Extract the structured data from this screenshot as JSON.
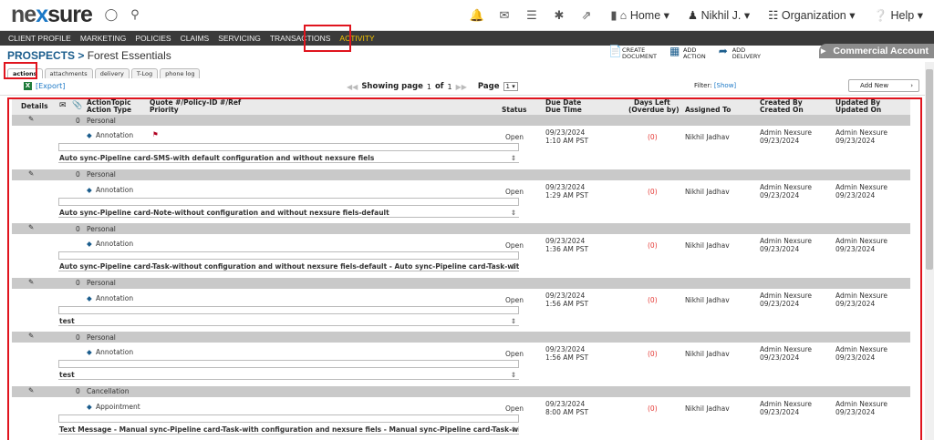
{
  "brand": {
    "logo_pre": "ne",
    "logo_x": "x",
    "logo_post": "sure"
  },
  "nav": {
    "home": "Home",
    "user": "Nikhil J.",
    "organization": "Organization",
    "help": "Help"
  },
  "menu": [
    "CLIENT PROFILE",
    "MARKETING",
    "POLICIES",
    "CLAIMS",
    "SERVICING",
    "TRANSACTIONS",
    "ACTIVITY"
  ],
  "breadcrumb": {
    "section": "PROSPECTS",
    "sep": ">",
    "name": "Forest Essentials"
  },
  "actions": {
    "create": [
      "CREATE",
      "DOCUMENT"
    ],
    "add_action": [
      "ADD",
      "ACTION"
    ],
    "add_delivery": [
      "ADD",
      "DELIVERY"
    ]
  },
  "commercial_account": "Commercial Account",
  "tabs": [
    "actions",
    "attachments",
    "delivery",
    "T-Log",
    "phone log"
  ],
  "toolbar": {
    "export": "[Export]",
    "showing": "Showing page",
    "page_num": "1",
    "of": "of",
    "page_total": "1",
    "page_label": "Page",
    "page_select": "1",
    "filter_label": "Filter:",
    "filter_link": "[Show]",
    "add_new": "Add New"
  },
  "columns": {
    "details": "Details",
    "topic": "ActionTopic",
    "action_type": "Action Type",
    "quote": "Quote #/Policy-ID #/Ref",
    "priority": "Priority",
    "status": "Status",
    "due_date": "Due Date",
    "due_time": "Due Time",
    "days_left": "Days Left",
    "overdue": "(Overdue by)",
    "assigned": "Assigned To",
    "created_by": "Created By",
    "created_on": "Created On",
    "updated_by": "Updated By",
    "updated_on": "Updated On"
  },
  "rows": [
    {
      "count": "0",
      "category": "Personal",
      "type": "Annotation",
      "status": "Open",
      "date": "09/23/2024",
      "time": "1:10 AM PST",
      "days": "(0)",
      "assigned": "Nikhil Jadhav",
      "created_by": "Admin Nexsure",
      "created_on": "09/23/2024",
      "updated_by": "Admin Nexsure",
      "updated_on": "09/23/2024",
      "note": "Auto sync-Pipeline card-SMS-with default configuration and without nexsure fiels",
      "flag": true
    },
    {
      "count": "0",
      "category": "Personal",
      "type": "Annotation",
      "status": "Open",
      "date": "09/23/2024",
      "time": "1:29 AM PST",
      "days": "(0)",
      "assigned": "Nikhil Jadhav",
      "created_by": "Admin Nexsure",
      "created_on": "09/23/2024",
      "updated_by": "Admin Nexsure",
      "updated_on": "09/23/2024",
      "note": "Auto sync-Pipeline card-Note-without configuration and without nexsure fiels-default",
      "flag": false
    },
    {
      "count": "0",
      "category": "Personal",
      "type": "Annotation",
      "status": "Open",
      "date": "09/23/2024",
      "time": "1:36 AM PST",
      "days": "(0)",
      "assigned": "Nikhil Jadhav",
      "created_by": "Admin Nexsure",
      "created_on": "09/23/2024",
      "updated_by": "Admin Nexsure",
      "updated_on": "09/23/2024",
      "note": "Auto sync-Pipeline card-Task-without configuration and without nexsure fiels-default - Auto sync-Pipeline card-Task-without",
      "flag": false
    },
    {
      "count": "0",
      "category": "Personal",
      "type": "Annotation",
      "status": "Open",
      "date": "09/23/2024",
      "time": "1:56 AM PST",
      "days": "(0)",
      "assigned": "Nikhil Jadhav",
      "created_by": "Admin Nexsure",
      "created_on": "09/23/2024",
      "updated_by": "Admin Nexsure",
      "updated_on": "09/23/2024",
      "note": "test",
      "flag": false
    },
    {
      "count": "0",
      "category": "Personal",
      "type": "Annotation",
      "status": "Open",
      "date": "09/23/2024",
      "time": "1:56 AM PST",
      "days": "(0)",
      "assigned": "Nikhil Jadhav",
      "created_by": "Admin Nexsure",
      "created_on": "09/23/2024",
      "updated_by": "Admin Nexsure",
      "updated_on": "09/23/2024",
      "note": "test",
      "flag": false
    },
    {
      "count": "0",
      "category": "Cancellation",
      "type": "Appointment",
      "status": "Open",
      "date": "09/23/2024",
      "time": "8:00 AM PST",
      "days": "(0)",
      "assigned": "Nikhil Jadhav",
      "created_by": "Admin Nexsure",
      "created_on": "09/23/2024",
      "updated_by": "Admin Nexsure",
      "updated_on": "09/23/2024",
      "note": "Text Message - Manual sync-Pipeline card-Task-with configuration and nexsure fiels - Manual sync-Pipeline card-Task-with",
      "flag": false
    }
  ],
  "colors": {
    "accent": "#1b78c6",
    "menu_bg": "#3a3a3a",
    "active_menu": "#f5c400",
    "highlight": "#e0141e"
  }
}
